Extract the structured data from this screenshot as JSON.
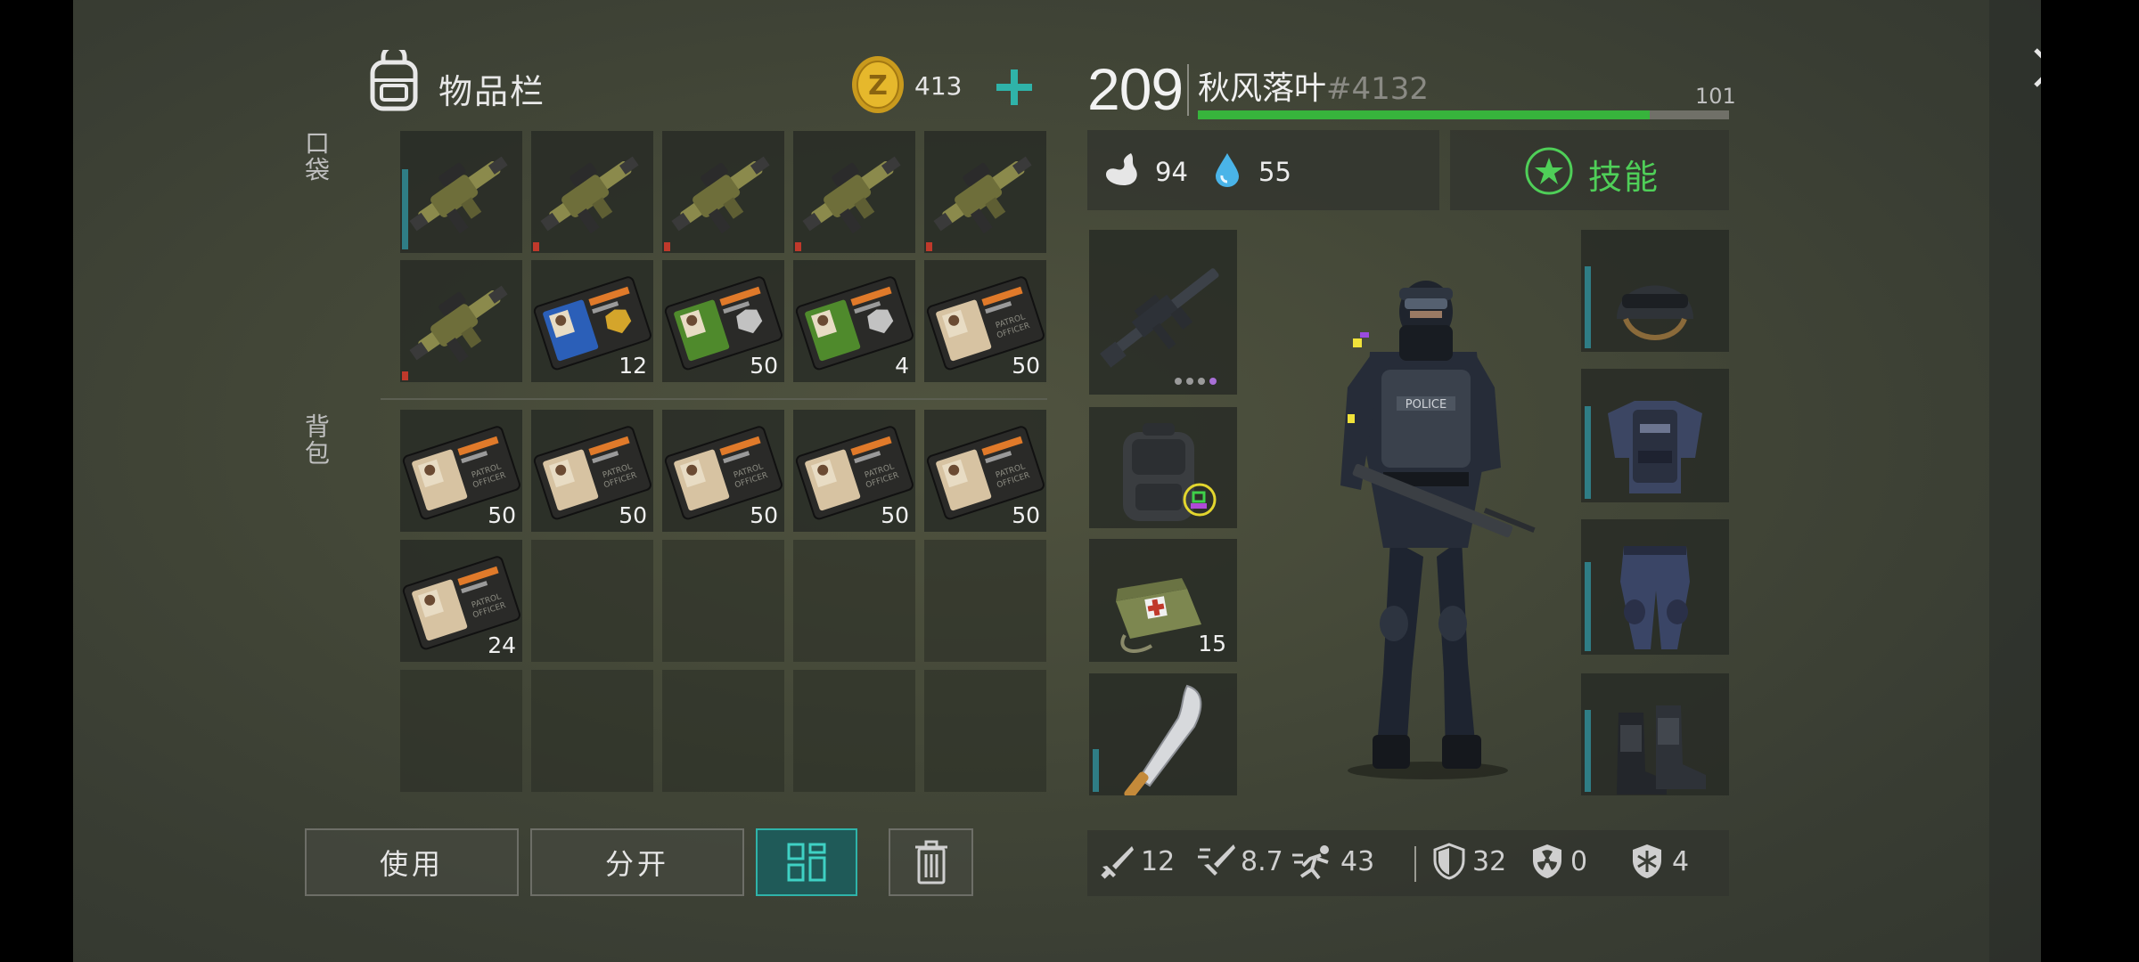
{
  "inventory": {
    "title": "物品栏",
    "coins": "413",
    "pocket_label": "口袋",
    "backpack_label": "背包",
    "pocket_slots": [
      {
        "item": "grenade-launcher",
        "count": ""
      },
      {
        "item": "grenade-launcher",
        "count": ""
      },
      {
        "item": "grenade-launcher",
        "count": ""
      },
      {
        "item": "grenade-launcher",
        "count": ""
      },
      {
        "item": "grenade-launcher",
        "count": ""
      },
      {
        "item": "grenade-launcher",
        "count": ""
      },
      {
        "item": "police-id-blue",
        "count": "12"
      },
      {
        "item": "police-id-green",
        "count": "50"
      },
      {
        "item": "police-id-green",
        "count": "4"
      },
      {
        "item": "patrol-officer-id",
        "count": "50"
      }
    ],
    "backpack_slots": [
      {
        "item": "patrol-officer-id",
        "count": "50"
      },
      {
        "item": "patrol-officer-id",
        "count": "50"
      },
      {
        "item": "patrol-officer-id",
        "count": "50"
      },
      {
        "item": "patrol-officer-id",
        "count": "50"
      },
      {
        "item": "patrol-officer-id",
        "count": "50"
      },
      {
        "item": "patrol-officer-id",
        "count": "24"
      }
    ],
    "buttons": {
      "use": "使用",
      "split": "分开"
    }
  },
  "character": {
    "level": "209",
    "name": "秋风落叶",
    "id_tag": "#4132",
    "xp_value": "101",
    "xp_fraction": 0.85,
    "food": "94",
    "water": "55",
    "skills_label": "技能",
    "weapon_slots": [
      {
        "item": "assault-rifle",
        "count": ""
      },
      {
        "item": "backpack",
        "count": ""
      },
      {
        "item": "medkit-bag",
        "count": "15"
      },
      {
        "item": "machete",
        "count": ""
      }
    ],
    "armor_slots": [
      "helmet",
      "vest",
      "pants",
      "boots"
    ],
    "stats": {
      "damage": "12",
      "attack_speed": "8.7",
      "speed": "43",
      "armor": "32",
      "radiation": "0",
      "cold": "4"
    }
  },
  "close_label": "关闭",
  "colors": {
    "xp_green": "#37b43c",
    "accent_teal": "#2fb3a9",
    "skill_green": "#4fcf58"
  }
}
